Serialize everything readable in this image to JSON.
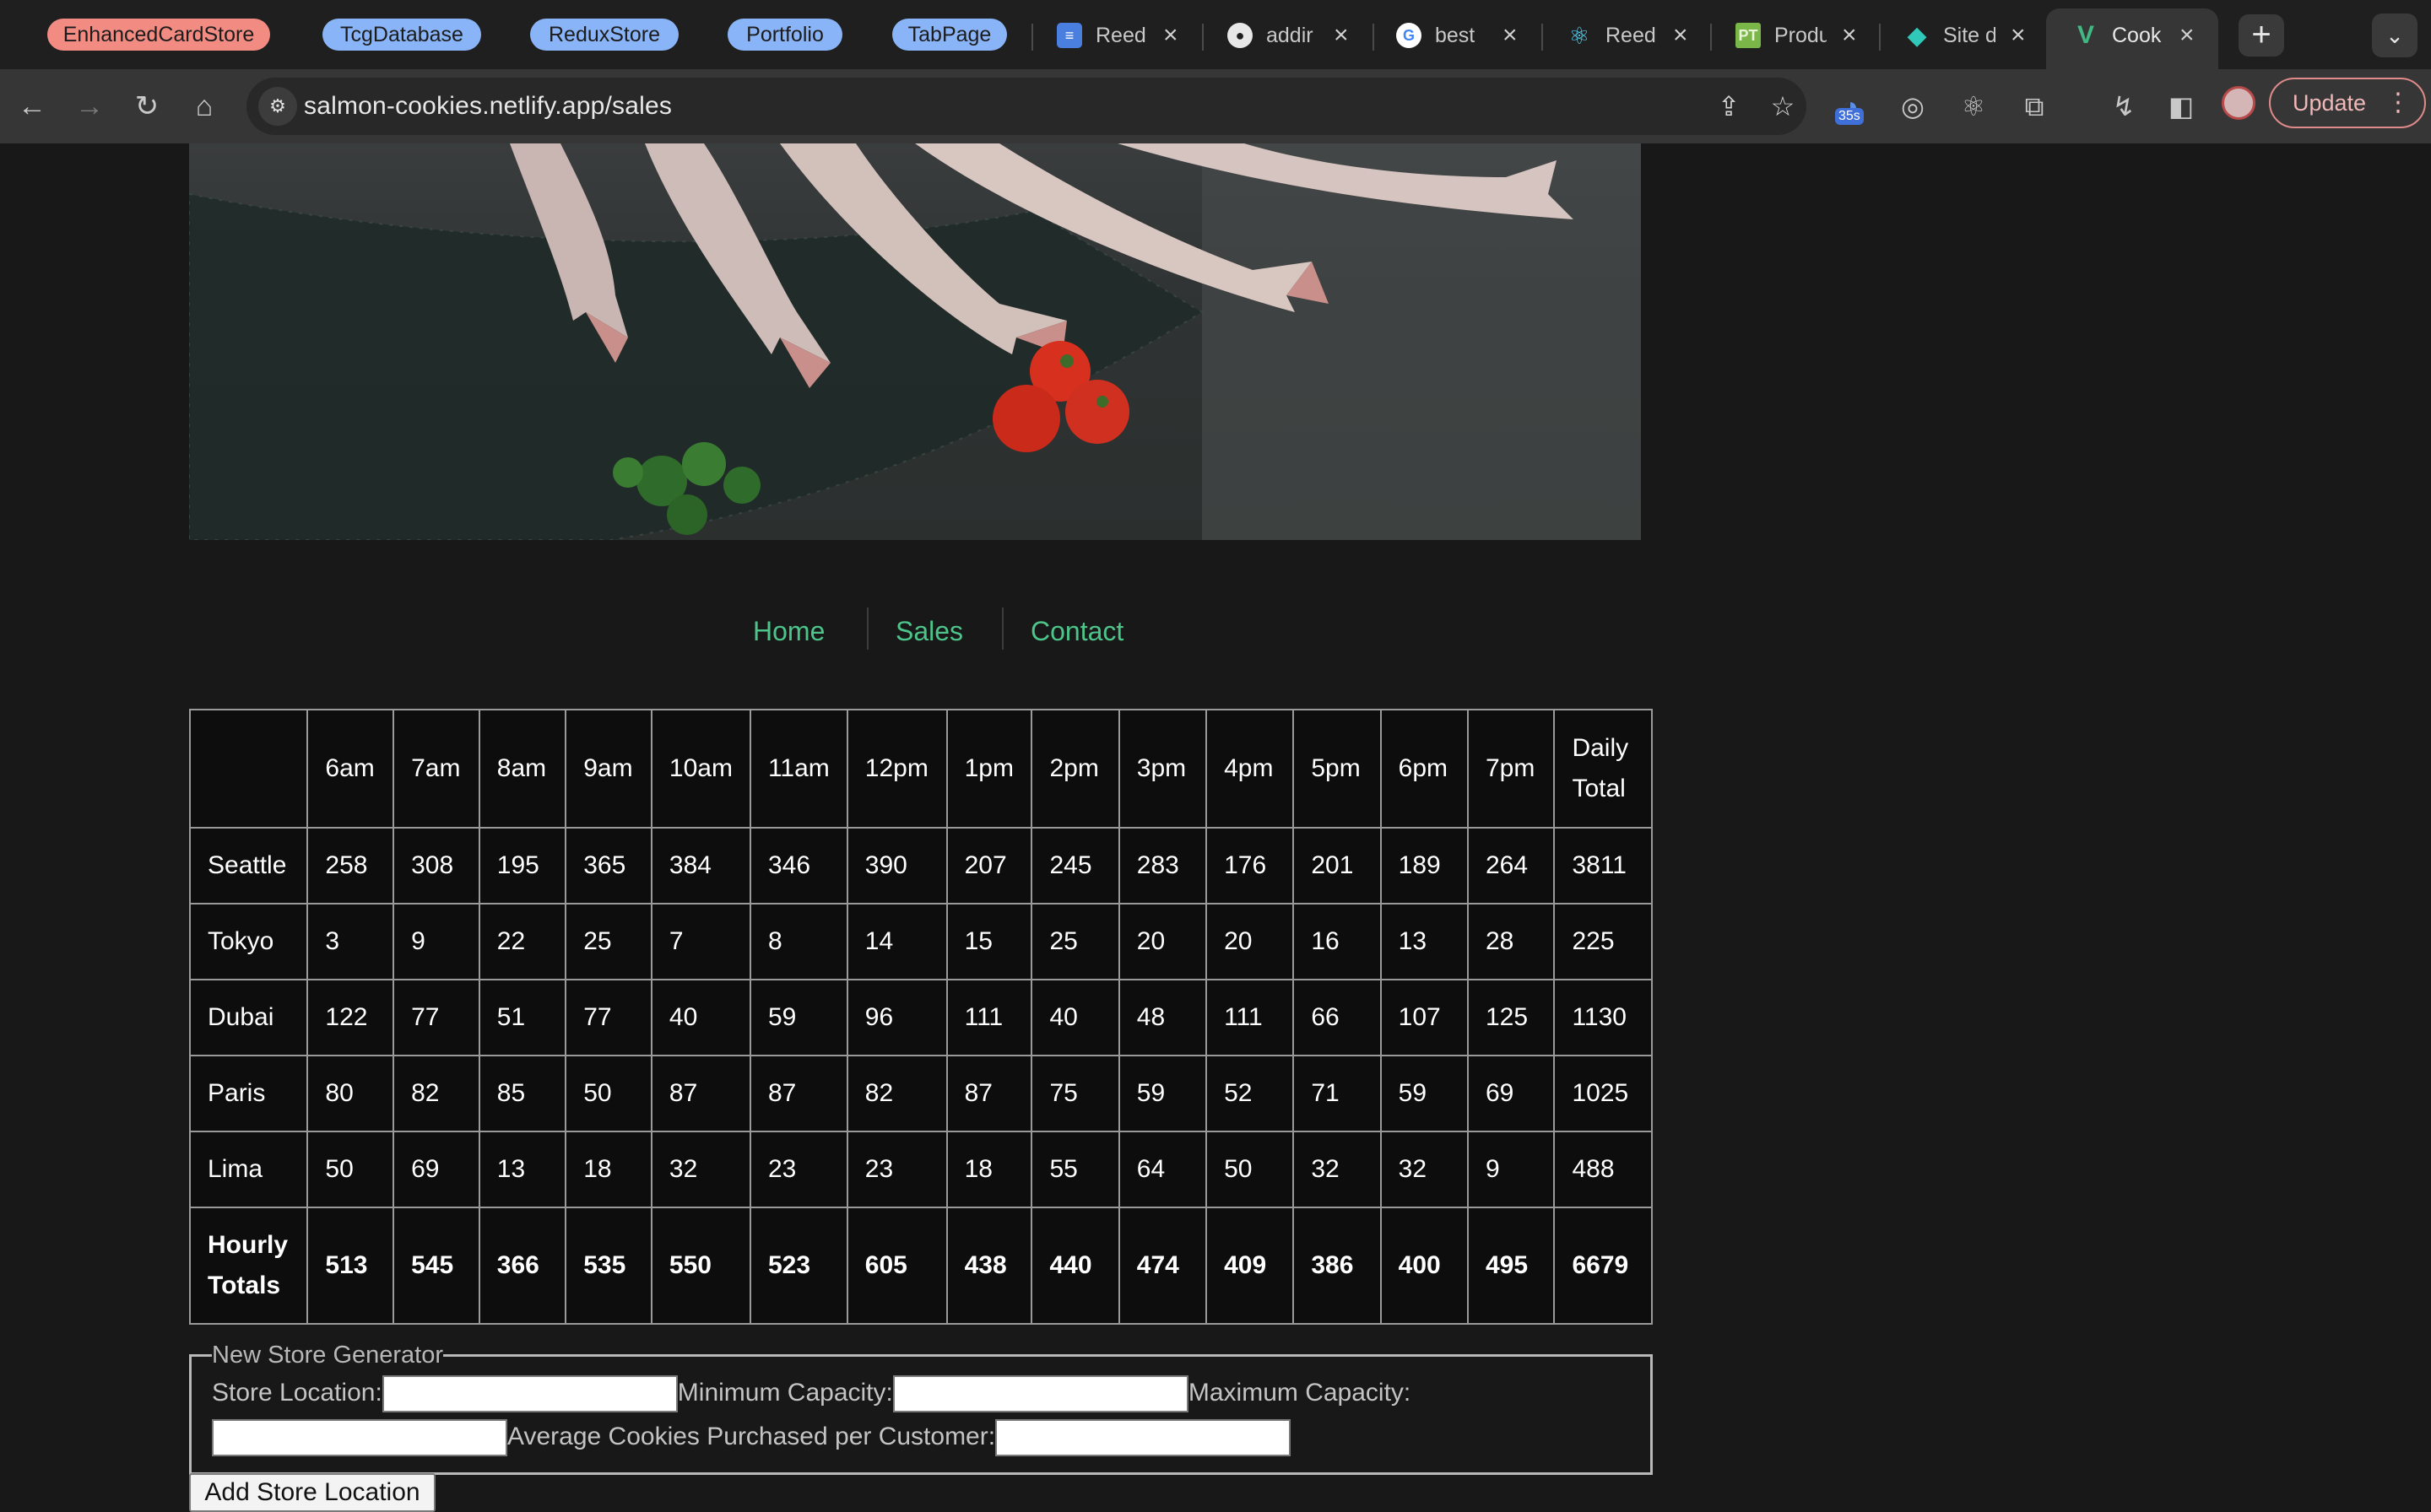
{
  "browser": {
    "tab_groups": [
      {
        "label": "EnhancedCardStore",
        "color": "#f28b82"
      },
      {
        "label": "TcgDatabase",
        "color": "#8ab4f8"
      },
      {
        "label": "ReduxStore",
        "color": "#8ab4f8"
      },
      {
        "label": "Portfolio",
        "color": "#8ab4f8"
      },
      {
        "label": "TabPage",
        "color": "#8ab4f8"
      }
    ],
    "tabs": [
      {
        "title": "Reed",
        "icon": "docs-icon"
      },
      {
        "title": "addir",
        "icon": "github-icon"
      },
      {
        "title": "best",
        "icon": "google-icon"
      },
      {
        "title": "Reed",
        "icon": "react-icon"
      },
      {
        "title": "Produ",
        "icon": "pt-icon",
        "icon_text": "PT"
      },
      {
        "title": "Site d",
        "icon": "netlify-icon"
      },
      {
        "title": "Cook",
        "icon": "vue-icon",
        "active": true
      }
    ],
    "url": "salmon-cookies.netlify.app/sales",
    "extension_badge": "35s",
    "update_label": "Update"
  },
  "nav": {
    "links": [
      "Home",
      "Sales",
      "Contact"
    ],
    "link_color": "#4cc48a"
  },
  "sales_table": {
    "headers": [
      "",
      "6am",
      "7am",
      "8am",
      "9am",
      "10am",
      "11am",
      "12pm",
      "1pm",
      "2pm",
      "3pm",
      "4pm",
      "5pm",
      "6pm",
      "7pm",
      "Daily Total"
    ],
    "rows": [
      {
        "location": "Seattle",
        "values": [
          258,
          308,
          195,
          365,
          384,
          346,
          390,
          207,
          245,
          283,
          176,
          201,
          189,
          264
        ],
        "total": 3811
      },
      {
        "location": "Tokyo",
        "values": [
          3,
          9,
          22,
          25,
          7,
          8,
          14,
          15,
          25,
          20,
          20,
          16,
          13,
          28
        ],
        "total": 225
      },
      {
        "location": "Dubai",
        "values": [
          122,
          77,
          51,
          77,
          40,
          59,
          96,
          111,
          40,
          48,
          111,
          66,
          107,
          125
        ],
        "total": 1130
      },
      {
        "location": "Paris",
        "values": [
          80,
          82,
          85,
          50,
          87,
          87,
          82,
          87,
          75,
          59,
          52,
          71,
          59,
          69
        ],
        "total": 1025
      },
      {
        "location": "Lima",
        "values": [
          50,
          69,
          13,
          18,
          32,
          23,
          23,
          18,
          55,
          64,
          50,
          32,
          32,
          9
        ],
        "total": 488
      }
    ],
    "footer": {
      "label": "Hourly Totals",
      "values": [
        513,
        545,
        366,
        535,
        550,
        523,
        605,
        438,
        440,
        474,
        409,
        386,
        400,
        495
      ],
      "total": 6679
    }
  },
  "form": {
    "legend": "New Store Generator",
    "store_location_label": "Store Location:",
    "min_capacity_label": "Minimum Capacity:",
    "max_capacity_label": "Maximum Capacity:",
    "avg_cookies_label": "Average Cookies Purchased per Customer:",
    "submit_label": "Add Store Location"
  }
}
